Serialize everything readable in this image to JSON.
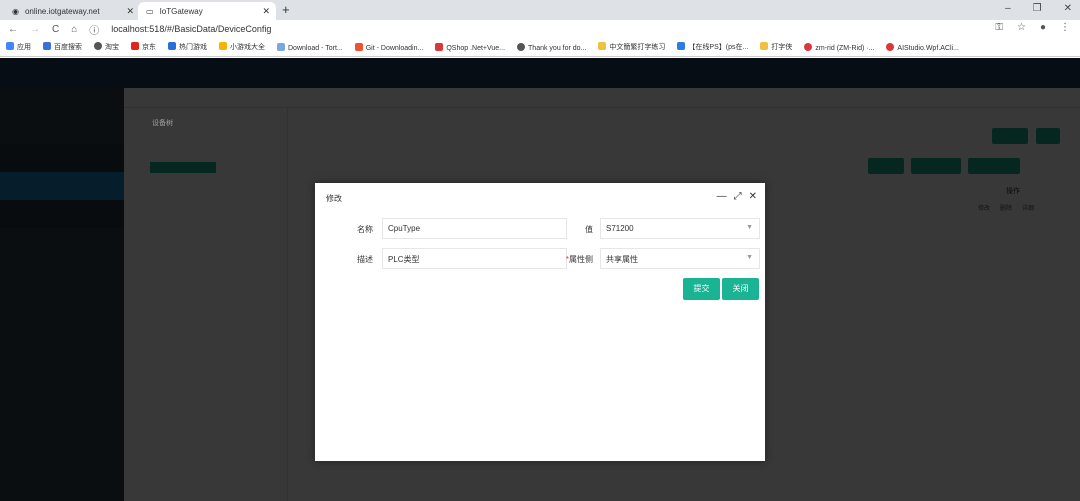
{
  "browser": {
    "tabs": [
      {
        "title": "online.iotgateway.net"
      },
      {
        "title": "IoTGateway"
      }
    ],
    "url": "localhost:518/#/BasicData/DeviceConfig",
    "bookmarks": [
      "应用",
      "百度搜索",
      "淘宝",
      "京东",
      "热门游戏",
      "小游戏大全",
      "Download - Tort...",
      "Git - Downloadin...",
      "QShop .Net+Vue...",
      "Thank you for do...",
      "中文簡繁打字练习",
      "【在线PS】(ps在...",
      "打字侠",
      "zm-rid (ZM-Rid) ·...",
      "AIStudio.Wpf.ACli..."
    ]
  },
  "page": {
    "tree_root": "设备树",
    "row_ops": [
      "修改",
      "删除",
      "详细"
    ],
    "column_header": "操作"
  },
  "modal": {
    "title": "修改",
    "fields": [
      {
        "label": "名称",
        "value": "CpuType"
      },
      {
        "label": "值",
        "value": "S71200"
      },
      {
        "label": "描述",
        "value": "PLC类型"
      },
      {
        "label": "属性侧",
        "value": "共享属性",
        "required": true
      }
    ],
    "submit_label": "提交",
    "close_label": "关闭"
  },
  "colors": {
    "accent": "#1ab394",
    "header": "#1b3b5e",
    "sidebar": "#2f4050"
  }
}
